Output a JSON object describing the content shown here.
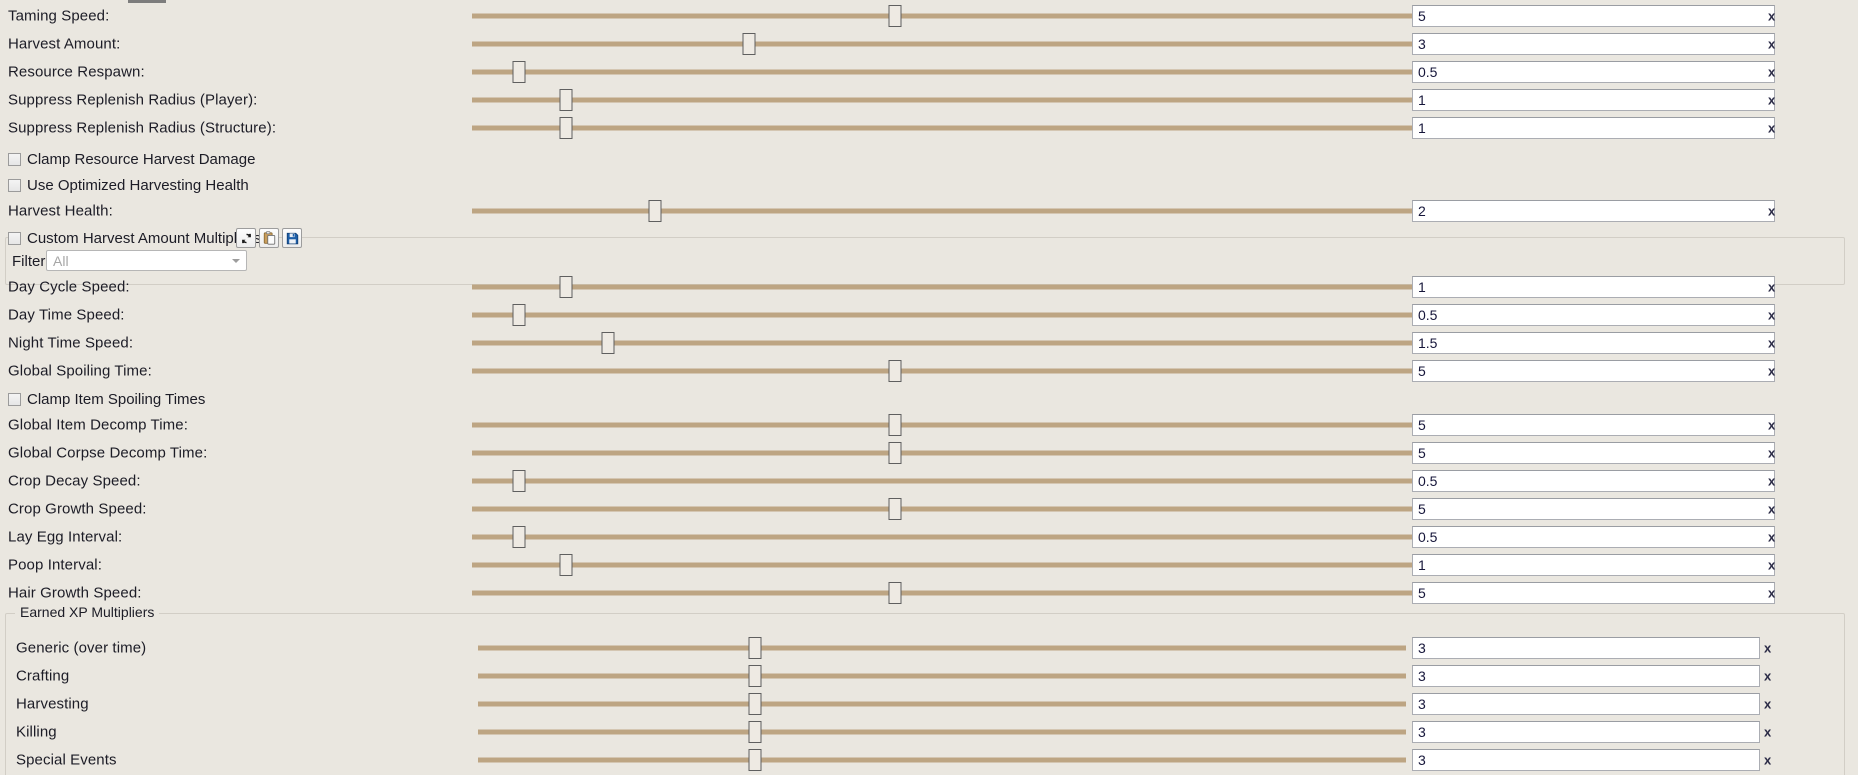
{
  "window": {
    "background_color": "#eae7e0",
    "slider_track_color": "#bda583",
    "multiplier_suffix": "x"
  },
  "sections": {
    "harvest": {
      "rows": [
        {
          "label": "Taming Speed:",
          "value": "5",
          "slider_pct": 45,
          "suffix": "x"
        },
        {
          "label": "Harvest Amount:",
          "value": "3",
          "slider_pct": 30,
          "suffix": "x"
        },
        {
          "label": "Resource Respawn:",
          "value": "0.5",
          "slider_pct": 5,
          "suffix": "x"
        },
        {
          "label": "Suppress Replenish Radius (Player):",
          "value": "1",
          "slider_pct": 10,
          "suffix": "x"
        },
        {
          "label": "Suppress Replenish Radius (Structure):",
          "value": "1",
          "slider_pct": 10,
          "suffix": "x"
        }
      ],
      "checkboxes": [
        {
          "label": "Clamp Resource Harvest Damage",
          "checked": false
        },
        {
          "label": "Use Optimized Harvesting Health",
          "checked": false
        }
      ],
      "harvest_health": {
        "label": "Harvest Health:",
        "value": "2",
        "slider_pct": 20,
        "suffix": "x"
      }
    },
    "custom_harvest": {
      "checkbox_label": "Custom Harvest Amount Multipliers",
      "checked": false,
      "toolbar": [
        {
          "name": "refresh-icon",
          "tooltip": "Refresh"
        },
        {
          "name": "paste-icon",
          "tooltip": "Paste"
        },
        {
          "name": "save-icon",
          "tooltip": "Save"
        }
      ],
      "filter_label": "Filter:",
      "filter_value": "All"
    },
    "time_and_decay": {
      "rows": [
        {
          "label": "Day Cycle Speed:",
          "value": "1",
          "slider_pct": 10,
          "suffix": "x"
        },
        {
          "label": "Day Time Speed:",
          "value": "0.5",
          "slider_pct": 5,
          "suffix": "x"
        },
        {
          "label": "Night Time Speed:",
          "value": "1.5",
          "slider_pct": 15,
          "suffix": "x"
        },
        {
          "label": "Global Spoiling Time:",
          "value": "5",
          "slider_pct": 50,
          "suffix": "x"
        }
      ],
      "checkbox": {
        "label": "Clamp Item Spoiling Times",
        "checked": false
      },
      "rows2": [
        {
          "label": "Global Item Decomp Time:",
          "value": "5",
          "slider_pct": 50,
          "suffix": "x"
        },
        {
          "label": "Global Corpse Decomp Time:",
          "value": "5",
          "slider_pct": 50,
          "suffix": "x"
        },
        {
          "label": "Crop Decay Speed:",
          "value": "0.5",
          "slider_pct": 5,
          "suffix": "x"
        },
        {
          "label": "Crop Growth Speed:",
          "value": "5",
          "slider_pct": 50,
          "suffix": "x"
        },
        {
          "label": "Lay Egg Interval:",
          "value": "0.5",
          "slider_pct": 5,
          "suffix": "x"
        },
        {
          "label": "Poop Interval:",
          "value": "1",
          "slider_pct": 11,
          "suffix": "x"
        },
        {
          "label": "Hair Growth Speed:",
          "value": "5",
          "slider_pct": 50,
          "suffix": "x"
        }
      ]
    },
    "earned_xp": {
      "title": "Earned XP Multipliers",
      "rows": [
        {
          "label": "Generic (over time)",
          "value": "3",
          "slider_pct": 30,
          "suffix": "x"
        },
        {
          "label": "Crafting",
          "value": "3",
          "slider_pct": 30,
          "suffix": "x"
        },
        {
          "label": "Harvesting",
          "value": "3",
          "slider_pct": 30,
          "suffix": "x"
        },
        {
          "label": "Killing",
          "value": "3",
          "slider_pct": 30,
          "suffix": "x"
        },
        {
          "label": "Special Events",
          "value": "3",
          "slider_pct": 30,
          "suffix": "x"
        }
      ]
    }
  }
}
